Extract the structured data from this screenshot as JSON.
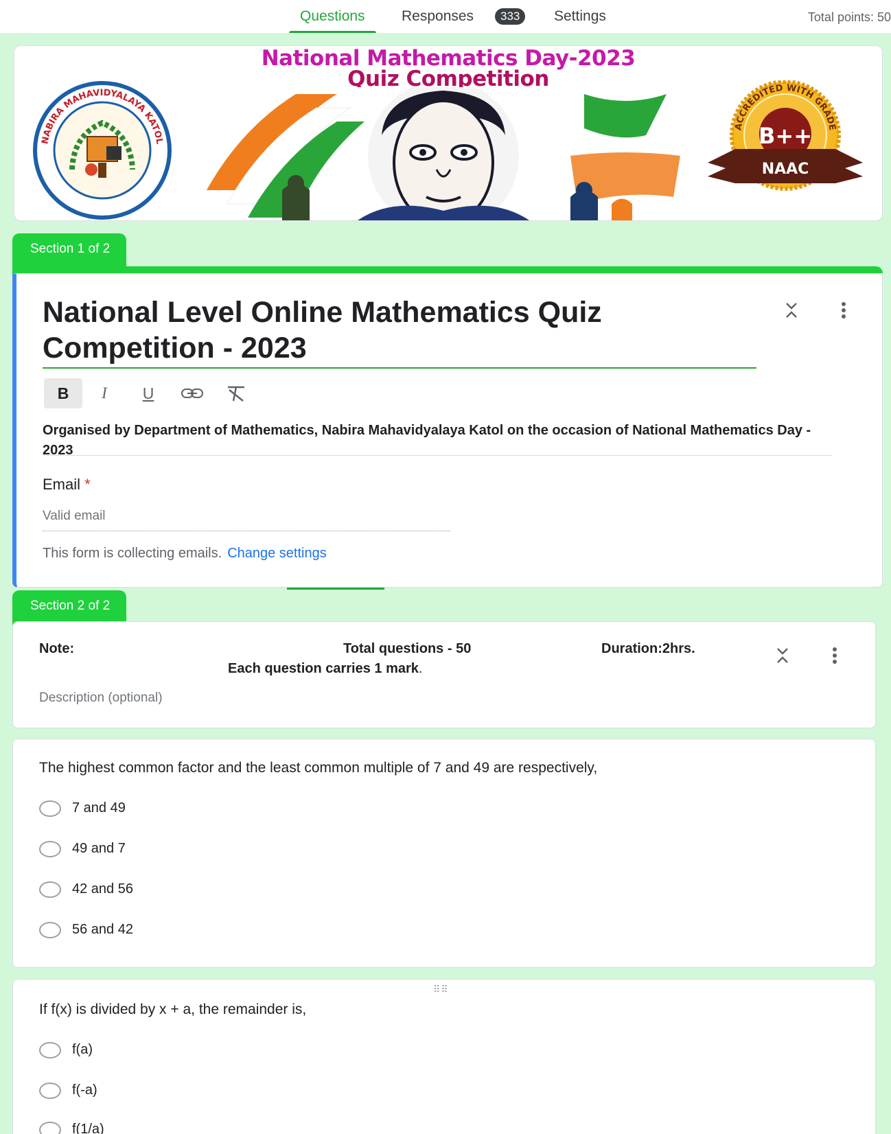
{
  "tabs": {
    "questions": "Questions",
    "responses": "Responses",
    "responses_count": "333",
    "settings": "Settings"
  },
  "total_points": "Total points: 50",
  "banner": {
    "line1": "National Mathematics Day-2023",
    "line2": "Quiz Competition",
    "seal_text": "NABIRA MAHAVIDYALAYA KATOL",
    "naac_grade": "B++",
    "naac_label": "NAAC",
    "naac_arc": "ACCREDITED WITH GRADE"
  },
  "section1": {
    "tab": "Section 1 of 2",
    "title": "National Level Online Mathematics Quiz Competition - 2023",
    "description": "Organised by Department of Mathematics, Nabira Mahavidyalaya Katol on the occasion of National Mathematics Day - 2023",
    "email_label": "Email",
    "required_mark": "*",
    "email_placeholder": "Valid email",
    "collecting_text": "This form is collecting emails.",
    "change_settings": "Change settings",
    "format": {
      "bold": "B",
      "italic": "I",
      "underline": "U"
    }
  },
  "section2": {
    "tab": "Section 2 of 2",
    "note": "Note:",
    "total_questions": "Total questions - 50",
    "duration": "Duration:2hrs.",
    "marks": "Each question carries 1 mark",
    "marks_period": ".",
    "description_placeholder": "Description (optional)"
  },
  "question1": {
    "text": "The highest common factor and the least common multiple of 7 and 49 are respectively,",
    "options": [
      "7 and 49",
      "49 and 7",
      "42 and 56",
      "56 and 42"
    ]
  },
  "question2": {
    "text": "If f(x) is divided by x + a, the remainder is,",
    "options": [
      "f(a)",
      "f(-a)",
      "f(1/a)"
    ]
  },
  "colors": {
    "accent": "#1fd13c",
    "background": "#d3f8d9",
    "focus": "#4285f4",
    "link": "#1a73e8",
    "banner_title": "#c41aa8"
  }
}
